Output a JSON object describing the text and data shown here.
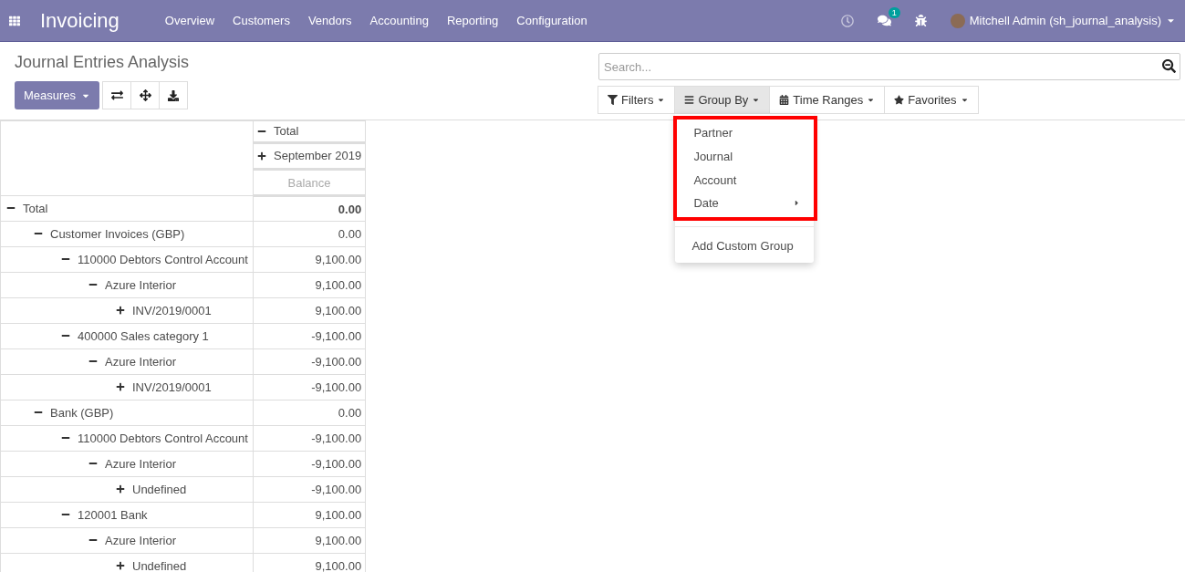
{
  "navbar": {
    "app_title": "Invoicing",
    "menu": [
      "Overview",
      "Customers",
      "Vendors",
      "Accounting",
      "Reporting",
      "Configuration"
    ],
    "message_count": "1",
    "user": "Mitchell Admin (sh_journal_analysis)"
  },
  "page_title": "Journal Entries Analysis",
  "measures_button": "Measures",
  "search": {
    "placeholder": "Search..."
  },
  "search_buttons": [
    {
      "label": "Filters",
      "kind": "filter",
      "selected": false
    },
    {
      "label": "Group By",
      "kind": "groupby",
      "selected": true
    },
    {
      "label": "Time Ranges",
      "kind": "timerange",
      "selected": false
    },
    {
      "label": "Favorites",
      "kind": "favorite",
      "selected": false
    }
  ],
  "group_by_menu": {
    "items": [
      {
        "label": "Partner",
        "kind": "option"
      },
      {
        "label": "Journal",
        "kind": "option"
      },
      {
        "label": "Account",
        "kind": "option"
      },
      {
        "label": "Date",
        "kind": "submenu"
      }
    ],
    "custom_label": "Add Custom Group"
  },
  "pivot": {
    "column_headers": [
      {
        "label": "Total",
        "expanded": true
      },
      {
        "label": "September 2019",
        "expanded": false
      }
    ],
    "measure": "Balance",
    "rows": [
      {
        "label": "Total",
        "value": "0.00",
        "expanded": true,
        "children": [
          {
            "label": "Customer Invoices (GBP)",
            "value": "0.00",
            "expanded": true,
            "children": [
              {
                "label": "110000 Debtors Control Account",
                "value": "9,100.00",
                "expanded": true,
                "children": [
                  {
                    "label": "Azure Interior",
                    "value": "9,100.00",
                    "expanded": true,
                    "children": [
                      {
                        "label": "INV/2019/0001",
                        "value": "9,100.00",
                        "expanded": false
                      }
                    ]
                  }
                ]
              },
              {
                "label": "400000 Sales category 1",
                "value": "-9,100.00",
                "expanded": true,
                "children": [
                  {
                    "label": "Azure Interior",
                    "value": "-9,100.00",
                    "expanded": true,
                    "children": [
                      {
                        "label": "INV/2019/0001",
                        "value": "-9,100.00",
                        "expanded": false
                      }
                    ]
                  }
                ]
              }
            ]
          },
          {
            "label": "Bank (GBP)",
            "value": "0.00",
            "expanded": true,
            "children": [
              {
                "label": "110000 Debtors Control Account",
                "value": "-9,100.00",
                "expanded": true,
                "children": [
                  {
                    "label": "Azure Interior",
                    "value": "-9,100.00",
                    "expanded": true,
                    "children": [
                      {
                        "label": "Undefined",
                        "value": "-9,100.00",
                        "expanded": false
                      }
                    ]
                  }
                ]
              },
              {
                "label": "120001 Bank",
                "value": "9,100.00",
                "expanded": true,
                "children": [
                  {
                    "label": "Azure Interior",
                    "value": "9,100.00",
                    "expanded": true,
                    "children": [
                      {
                        "label": "Undefined",
                        "value": "9,100.00",
                        "expanded": false
                      }
                    ]
                  }
                ]
              }
            ]
          }
        ]
      }
    ]
  }
}
